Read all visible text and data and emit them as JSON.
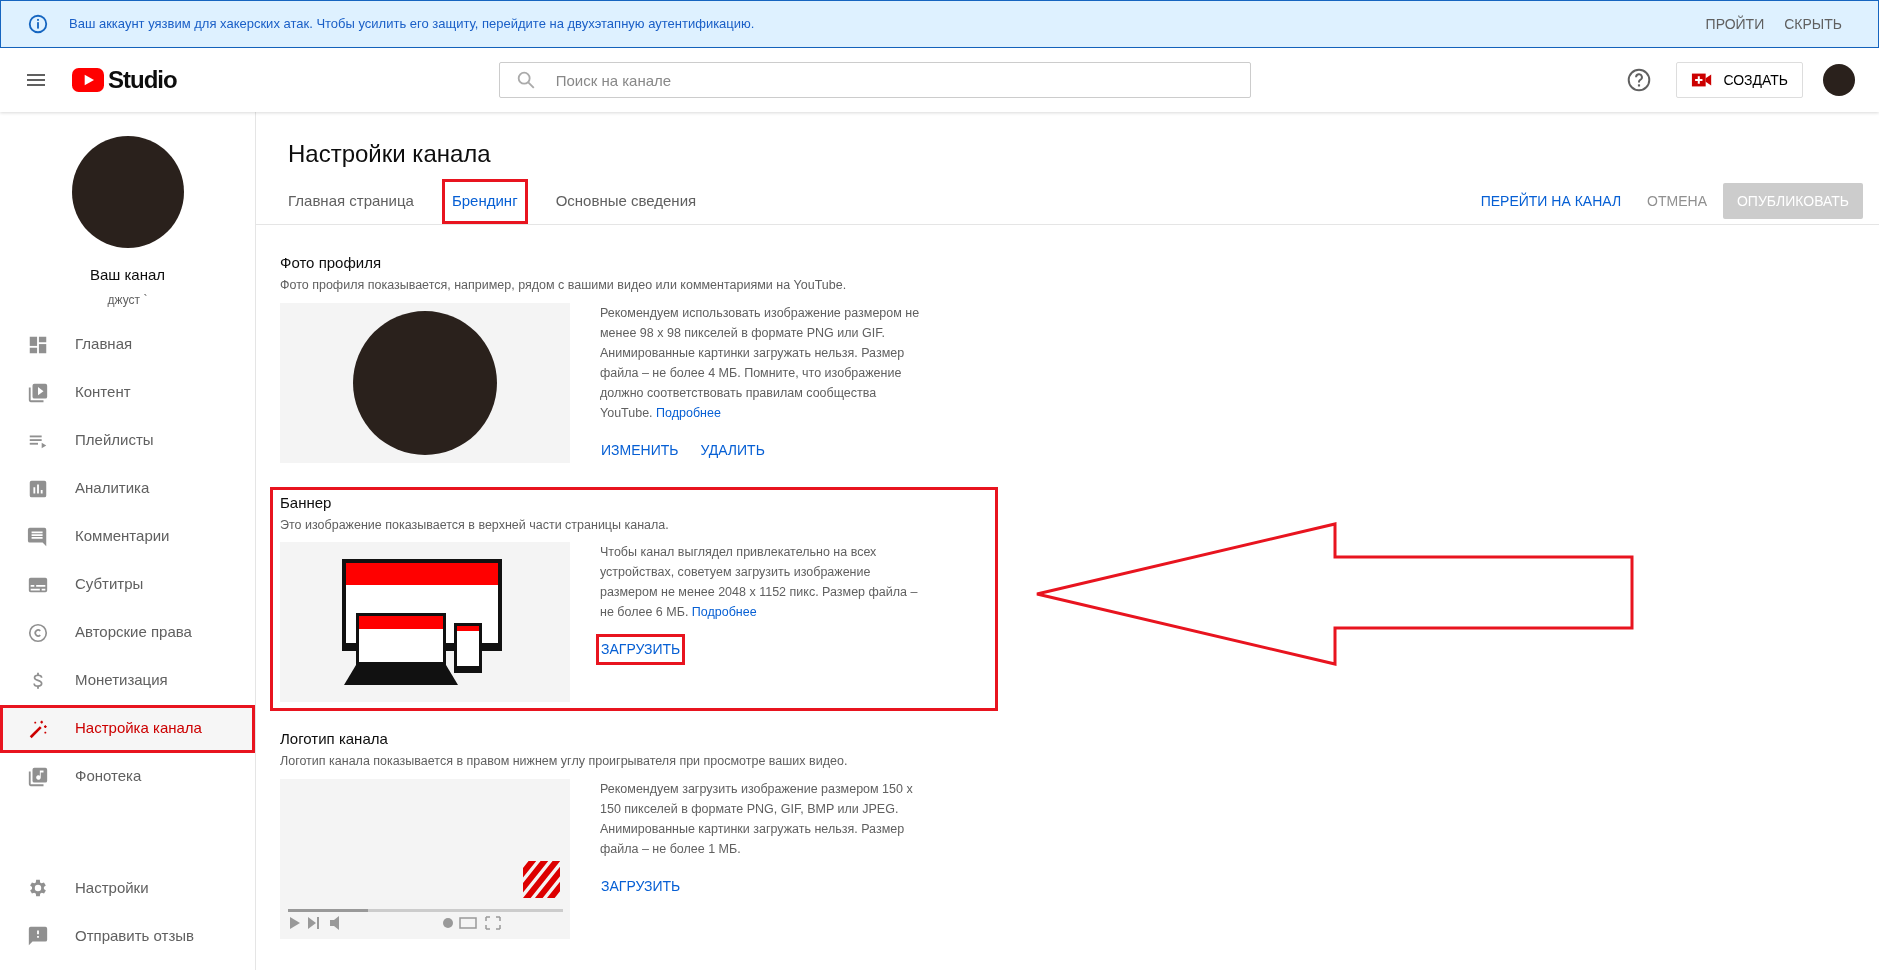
{
  "alert": {
    "text": "Ваш аккаунт уязвим для хакерских атак. Чтобы усилить его защиту, перейдите на двухэтапную аутентификацию.",
    "actions": [
      "ПРОЙТИ",
      "СКРЫТЬ"
    ]
  },
  "header": {
    "logo_text": "Studio",
    "search": {
      "placeholder": "Поиск на канале"
    },
    "create_button": "СОЗДАТЬ"
  },
  "sidebar": {
    "channel_name": "Ваш канал",
    "channel_handle": "джуст `",
    "items": [
      {
        "label": "Главная",
        "selected": false,
        "highlighted": false
      },
      {
        "label": "Контент",
        "selected": false,
        "highlighted": false
      },
      {
        "label": "Плейлисты",
        "selected": false,
        "highlighted": false
      },
      {
        "label": "Аналитика",
        "selected": false,
        "highlighted": false
      },
      {
        "label": "Комментарии",
        "selected": false,
        "highlighted": false
      },
      {
        "label": "Субтитры",
        "selected": false,
        "highlighted": false
      },
      {
        "label": "Авторские права",
        "selected": false,
        "highlighted": false
      },
      {
        "label": "Монетизация",
        "selected": false,
        "highlighted": false
      },
      {
        "label": "Настройка канала",
        "selected": true,
        "highlighted": true
      },
      {
        "label": "Фонотека",
        "selected": false,
        "highlighted": false
      }
    ],
    "bottom_items": [
      {
        "label": "Настройки"
      },
      {
        "label": "Отправить отзыв"
      }
    ]
  },
  "page": {
    "title": "Настройки канала",
    "tabs": [
      {
        "label": "Главная страница",
        "selected": false,
        "highlighted": false
      },
      {
        "label": "Брендинг",
        "selected": true,
        "highlighted": true
      },
      {
        "label": "Основные сведения",
        "selected": false,
        "highlighted": false
      }
    ],
    "actions": {
      "view_channel": "ПЕРЕЙТИ НА КАНАЛ",
      "cancel": "ОТМЕНА",
      "publish": {
        "label": "ОПУБЛИКОВАТЬ",
        "disabled": true
      }
    }
  },
  "sections": [
    {
      "kind": "profile",
      "title": "Фото профиля",
      "description": "Фото профиля показывается, например, рядом с вашими видео или комментариями на YouTube.",
      "info": "Рекомендуем использовать изображение размером не менее 98 x 98 пикселей в формате PNG или GIF. Анимированные картинки загружать нельзя. Размер файла – не более 4 МБ. Помните, что изображение должно соответствовать правилам сообщества YouTube.",
      "link": "Подробнее",
      "highlighted": false,
      "buttons": [
        {
          "label": "ИЗМЕНИТЬ",
          "highlighted": false
        },
        {
          "label": "УДАЛИТЬ",
          "highlighted": false
        }
      ]
    },
    {
      "kind": "banner",
      "title": "Баннер",
      "description": "Это изображение показывается в верхней части страницы канала.",
      "info": "Чтобы канал выглядел привлекательно на всех устройствах, советуем загрузить изображение размером не менее 2048 x 1152 пикс. Размер файла – не более 6 МБ.",
      "link": "Подробнее",
      "highlighted": true,
      "buttons": [
        {
          "label": "ЗАГРУЗИТЬ",
          "highlighted": true
        }
      ]
    },
    {
      "kind": "logo",
      "title": "Логотип канала",
      "description": "Логотип канала показывается в правом нижнем углу проигрывателя при просмотре ваших видео.",
      "info": "Рекомендуем загрузить изображение размером 150 x 150 пикселей в формате PNG, GIF, BMP или JPEG. Анимированные картинки загружать нельзя. Размер файла – не более 1 МБ.",
      "highlighted": false,
      "buttons": [
        {
          "label": "ЗАГРУЗИТЬ",
          "highlighted": false
        }
      ]
    }
  ],
  "callout_arrow": true
}
